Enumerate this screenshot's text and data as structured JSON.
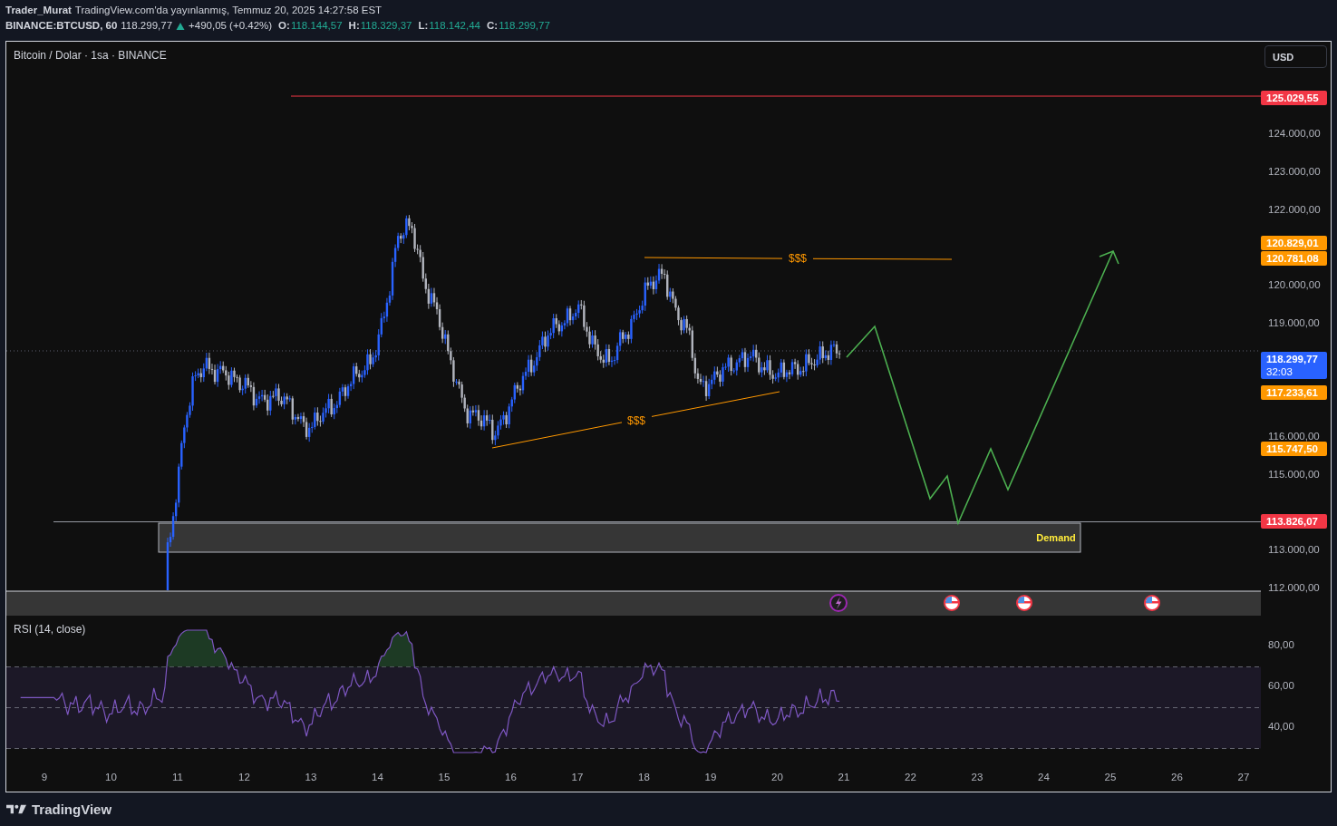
{
  "header": {
    "author": "Trader_Murat",
    "published": "TradingView.com'da yayınlanmış, Temmuz 20, 2025 14:27:58 EST",
    "symbol": "BINANCE:BTCUSD, 60",
    "last_price": "118.299,77",
    "change": "+490,05 (+0.42%)",
    "ohlc": [
      {
        "label": "O:",
        "value": "118.144,57"
      },
      {
        "label": "H:",
        "value": "118.329,37"
      },
      {
        "label": "L:",
        "value": "118.142,44"
      },
      {
        "label": "C:",
        "value": "118.299,77"
      }
    ]
  },
  "chart": {
    "legend": "Bitcoin / Dolar · 1sa · BINANCE",
    "currency_button": "USD",
    "price_ticks": [
      "124.000,00",
      "123.000,00",
      "122.000,00",
      "120.000,00",
      "119.000,00",
      "116.000,00",
      "115.000,00",
      "113.000,00",
      "112.000,00"
    ],
    "price_labels": [
      {
        "text": "125.029,55",
        "color": "#f23645"
      },
      {
        "text": "120.829,01",
        "color": "#ff9800"
      },
      {
        "text": "120.781,08",
        "color": "#ff9800"
      },
      {
        "text": "118.299,77",
        "countdown": "32:03",
        "color": "#2962ff"
      },
      {
        "text": "117.233,61",
        "color": "#ff9800"
      },
      {
        "text": "115.747,50",
        "color": "#ff9800"
      },
      {
        "text": "113.826,07",
        "color": "#f23645"
      }
    ],
    "annotations": [
      {
        "kind": "liquidity",
        "text": "$$$"
      },
      {
        "kind": "liquidity",
        "text": "$$$"
      },
      {
        "kind": "zone",
        "text": "Demand"
      }
    ]
  },
  "rsi": {
    "title": "RSI (14, close)",
    "ticks": [
      "80,00",
      "60,00",
      "40,00"
    ]
  },
  "time_axis": [
    "9",
    "10",
    "11",
    "12",
    "13",
    "14",
    "15",
    "16",
    "17",
    "18",
    "19",
    "20",
    "21",
    "22",
    "23",
    "24",
    "25",
    "26",
    "27"
  ],
  "footer": {
    "brand": "TradingView"
  }
}
